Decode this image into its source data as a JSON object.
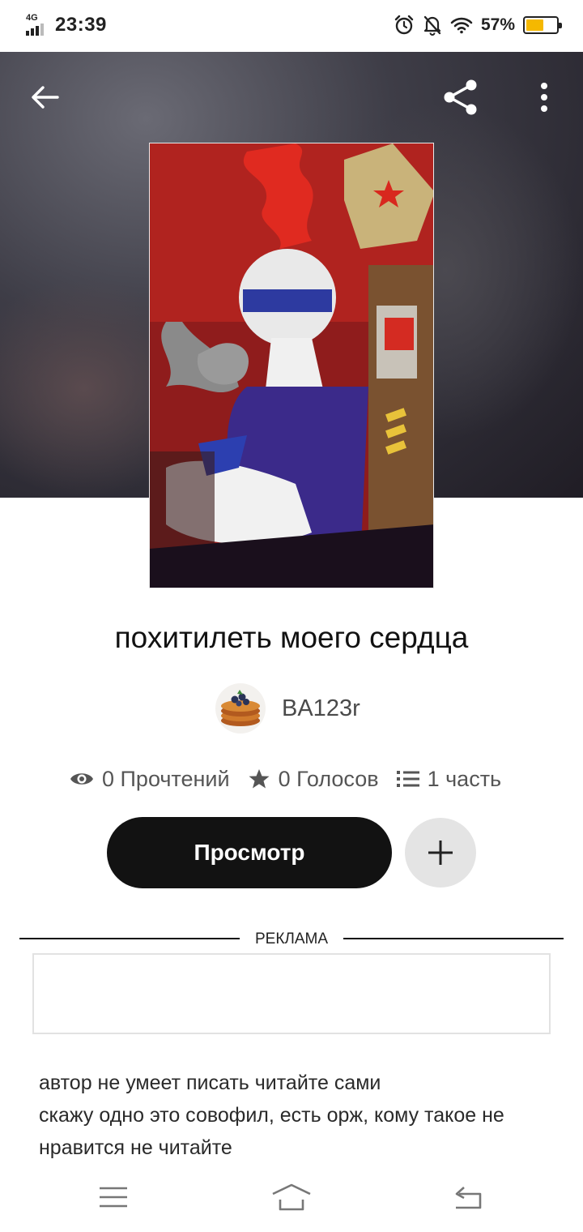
{
  "status_bar": {
    "network": "4G",
    "time": "23:39",
    "battery_percent": "57%",
    "battery_level": 0.57,
    "icons": [
      "alarm-icon",
      "bell-off-icon",
      "wifi-icon",
      "battery-icon"
    ]
  },
  "hero": {
    "back_icon": "arrow-left-icon",
    "share_icon": "share-icon",
    "more_icon": "more-vertical-icon"
  },
  "story": {
    "title": "похитилеть моего сердца",
    "author": "BA123r",
    "stats": {
      "reads": "0 Прочтений",
      "votes": "0 Голосов",
      "parts": "1 часть"
    },
    "view_button": "Просмотр",
    "add_icon": "plus-icon"
  },
  "ad": {
    "label": "РЕКЛАМА"
  },
  "description": [
    "автор не умеет писать читайте сами",
    "скажу одно это совофил, есть орж, кому такое не нравится не читайте"
  ],
  "nav": {
    "icons": [
      "menu-icon",
      "home-icon",
      "back-icon"
    ]
  },
  "colors": {
    "primary_button": "#121212",
    "battery_fill": "#f5b800",
    "secondary_button": "#e4e4e4"
  }
}
